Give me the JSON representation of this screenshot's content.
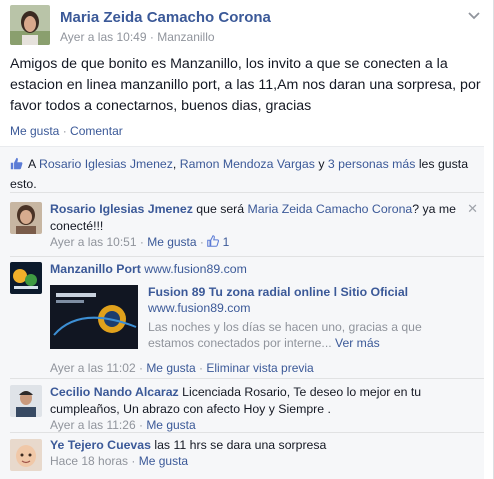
{
  "post": {
    "author": "Maria Zeida Camacho Corona",
    "time": "Ayer a las 10:49",
    "location": "Manzanillo",
    "text": "Amigos de que bonito es Manzanillo, los invito a que se conecten a la estacion en linea manzanillo port, a las 11,Am nos daran una sorpresa, por favor todos a conectarnos, buenos dias, gracias",
    "actions": {
      "like": "Me gusta",
      "comment": "Comentar"
    }
  },
  "likes": {
    "prefix": "A",
    "user1": "Rosario Iglesias Jmenez",
    "sep": ",",
    "user2": "Ramon Mendoza Vargas",
    "and": "y",
    "others": "3 personas más",
    "suffix": "les gusta esto."
  },
  "comments": [
    {
      "author": "Rosario Iglesias Jmenez",
      "text_before": "que será",
      "mention": "Maria Zeida Camacho Corona",
      "text_after": "? ya me conecté!!!",
      "time": "Ayer a las 10:51",
      "like": "Me gusta",
      "like_count": "1"
    },
    {
      "author": "Manzanillo Port",
      "link": "www.fusion89.com",
      "preview_title": "Fusion 89 Tu zona radial online l Sitio Oficial",
      "preview_url": "www.fusion89.com",
      "preview_desc": "Las noches y los días se hacen uno, gracias a que estamos conectados por interne...",
      "preview_more": "Ver más",
      "time": "Ayer a las 11:02",
      "like": "Me gusta",
      "remove": "Eliminar vista previa"
    },
    {
      "author": "Cecilio Nando Alcaraz",
      "text": "Licenciada Rosario, Te deseo lo mejor en tu cumpleaños, Un abrazo con afecto Hoy y Siempre .",
      "time": "Ayer a las 11:26",
      "like": "Me gusta"
    },
    {
      "author": "Ye Tejero Cuevas",
      "text": "las 11 hrs se dara una sorpresa",
      "time": "Hace 18 horas",
      "like": "Me gusta"
    }
  ],
  "icons": {
    "chevron": "chevron-down-icon",
    "thumb": "thumbs-up-icon",
    "close": "close-icon"
  },
  "colors": {
    "link": "#3b5998",
    "meta": "#90949c",
    "bg_feed": "#f6f7f9"
  }
}
